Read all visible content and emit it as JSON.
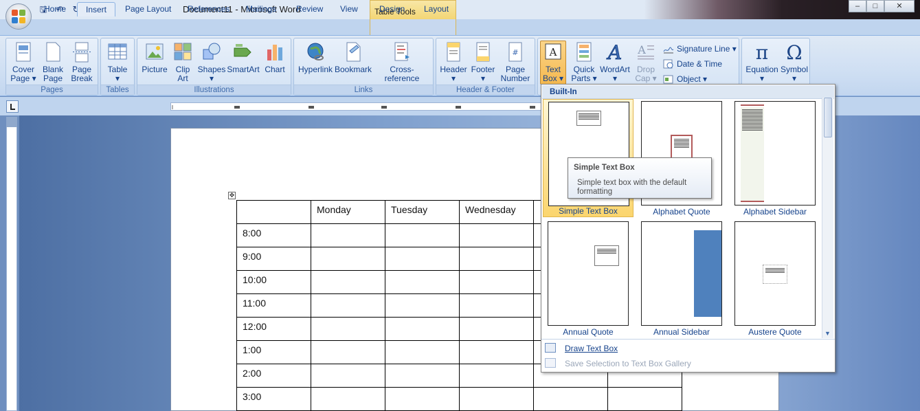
{
  "window": {
    "title": "Document11 - Microsoft Word",
    "context_tab_group": "Table Tools",
    "controls": [
      "–",
      "□",
      "✕"
    ]
  },
  "tabs": [
    "Home",
    "Insert",
    "Page Layout",
    "References",
    "Mailings",
    "Review",
    "View",
    "Design",
    "Layout"
  ],
  "active_tab": "Insert",
  "ribbon": {
    "pages": {
      "label": "Pages",
      "cover": [
        "Cover",
        "Page ▾"
      ],
      "blank": [
        "Blank",
        "Page"
      ],
      "break": [
        "Page",
        "Break"
      ]
    },
    "tables": {
      "label": "Tables",
      "table": [
        "Table",
        "▾"
      ]
    },
    "illustrations": {
      "label": "Illustrations",
      "picture": "Picture",
      "clipart": [
        "Clip",
        "Art"
      ],
      "shapes": [
        "Shapes",
        "▾"
      ],
      "smartart": "SmartArt",
      "chart": "Chart"
    },
    "links": {
      "label": "Links",
      "hyperlink": "Hyperlink",
      "bookmark": "Bookmark",
      "crossref": "Cross-reference"
    },
    "headerfooter": {
      "label": "Header & Footer",
      "header": [
        "Header",
        "▾"
      ],
      "footer": [
        "Footer",
        "▾"
      ],
      "pagenum": [
        "Page",
        "Number ▾"
      ]
    },
    "text": {
      "textbox": [
        "Text",
        "Box ▾"
      ],
      "quickparts": [
        "Quick",
        "Parts ▾"
      ],
      "wordart": [
        "WordArt",
        "▾"
      ],
      "dropcap": [
        "Drop",
        "Cap ▾"
      ],
      "signature": "Signature Line ▾",
      "datetime": "Date & Time",
      "object": "Object ▾"
    },
    "symbols": {
      "equation": [
        "Equation",
        "▾"
      ],
      "symbol": [
        "Symbol",
        "▾"
      ]
    }
  },
  "table": {
    "headers": [
      "",
      "Monday",
      "Tuesday",
      "Wednesday",
      "",
      ""
    ],
    "rows": [
      "8:00",
      "9:00",
      "10:00",
      "11:00",
      "12:00",
      "1:00",
      "2:00",
      "3:00"
    ]
  },
  "gallery": {
    "header": "Built-In",
    "items": [
      "Simple Text Box",
      "Alphabet Quote",
      "Alphabet Sidebar",
      "Annual Quote",
      "Annual Sidebar",
      "Austere Quote"
    ],
    "draw_text_box": "Draw Text Box",
    "save_selection": "Save Selection to Text Box Gallery"
  },
  "tooltip": {
    "title": "Simple Text Box",
    "description": "Simple text box with the default formatting"
  },
  "colors": {
    "accent": "#15428b",
    "ribbon": "#dfe9f5",
    "selection": "#fbd56e",
    "sidebar_blue": "#4f81bd"
  }
}
